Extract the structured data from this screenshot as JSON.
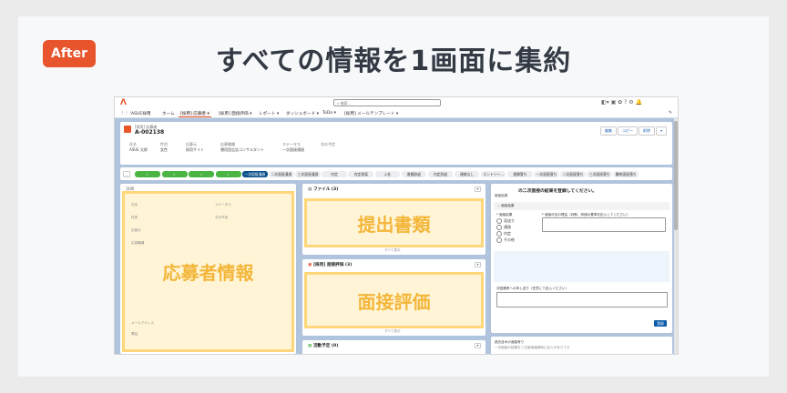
{
  "badge": "After",
  "headline": "すべての情報を1画面に集約",
  "app": {
    "name": "ASUE採用",
    "search_placeholder": "検索...",
    "util_icons": "◧▾ ▣ ✿ ? ⚙ 🔔"
  },
  "nav": {
    "items": [
      {
        "label": "ホーム",
        "active": false
      },
      {
        "label": "[採用] 応募者",
        "active": true
      },
      {
        "label": "[採用] 面接評価",
        "active": false
      },
      {
        "label": "レポート",
        "active": false
      },
      {
        "label": "ダッシュボード",
        "active": false
      },
      {
        "label": "ToDo",
        "active": false
      },
      {
        "label": "[採用] メールテンプレート",
        "active": false
      }
    ]
  },
  "record": {
    "type": "[採用] 応募者",
    "name": "A-002138",
    "buttons": [
      "編集",
      "コピー",
      "削除",
      "▾"
    ],
    "fields": [
      {
        "label": "氏名",
        "value": "ASUE 太郎"
      },
      {
        "label": "性別",
        "value": "女性"
      },
      {
        "label": "応募元",
        "value": "採用サイト"
      },
      {
        "label": "応募職種",
        "value": "運用型広告コンサルタント"
      },
      {
        "label": "ステータス",
        "value": "一次面接通過"
      },
      {
        "label": "次の予定",
        "value": ""
      }
    ]
  },
  "path": {
    "steps": [
      {
        "label": "✓",
        "state": "done"
      },
      {
        "label": "✓",
        "state": "done"
      },
      {
        "label": "✓",
        "state": "done"
      },
      {
        "label": "✓",
        "state": "done"
      },
      {
        "label": "一次面接通過",
        "state": "current"
      },
      {
        "label": "二次面接通過",
        "state": "todo"
      },
      {
        "label": "三次面接通過",
        "state": "todo"
      },
      {
        "label": "内定",
        "state": "todo"
      },
      {
        "label": "内定承諾",
        "state": "todo"
      },
      {
        "label": "入社",
        "state": "todo"
      },
      {
        "label": "書類辞退",
        "state": "todo"
      },
      {
        "label": "内定辞退",
        "state": "todo"
      },
      {
        "label": "連絡なし",
        "state": "todo"
      },
      {
        "label": "エントリー...",
        "state": "todo"
      },
      {
        "label": "書類落ち",
        "state": "todo"
      },
      {
        "label": "一次面接落ち",
        "state": "todo"
      },
      {
        "label": "二次面接落ち",
        "state": "todo"
      },
      {
        "label": "三次面接落ち",
        "state": "todo"
      },
      {
        "label": "最終面接落ち",
        "state": "todo"
      }
    ]
  },
  "left_panel": {
    "title": "詳細",
    "highlight": "応募者情報",
    "labels": [
      "氏名",
      "性別",
      "応募元",
      "応募職種",
      "ステータス",
      "次の予定",
      "メールアドレス",
      "電話",
      "年齢",
      "住所"
    ]
  },
  "files_panel": {
    "title": "ファイル (3)",
    "highlight": "提出書類",
    "view_all": "すべて表示"
  },
  "eval_panel": {
    "title": "[採用] 面接評価 (3)",
    "highlight": "面接評価",
    "view_all": "すべて表示"
  },
  "activity_panel": {
    "title": "活動予定 (0)"
  },
  "right_panel": {
    "notice": "の二次面接の結果を登録してください。",
    "sub": "面接結果",
    "section": "面接結果",
    "result_label": "* 面接結果",
    "reason_label": "* 面接可否の理由（判断、評価の基準を記入してください）",
    "options": [
      "見送り",
      "通過",
      "内定",
      "その他"
    ],
    "next_label": "次回選考への申し送り（任意にて記入ください）",
    "save": "登録",
    "footer_title": "過去含みの面接有り",
    "footer_text": "一次面接の結果を三次面接通過時に記入がありです"
  },
  "colors": {
    "accent": "#e8542b",
    "highlight_border": "#ffd77a",
    "highlight_text": "#f4b63a",
    "path_done": "#4bb543",
    "path_current": "#0b4f8a",
    "background": "#b0c4de"
  }
}
